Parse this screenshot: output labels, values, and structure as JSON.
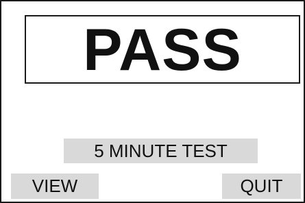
{
  "result": {
    "text": "PASS"
  },
  "test": {
    "label": "5 MINUTE TEST"
  },
  "softkeys": {
    "view_label": "VIEW",
    "quit_label": "QUIT"
  },
  "colors": {
    "foreground": "#111111",
    "key_background": "#d9d9d9",
    "background": "#ffffff"
  }
}
